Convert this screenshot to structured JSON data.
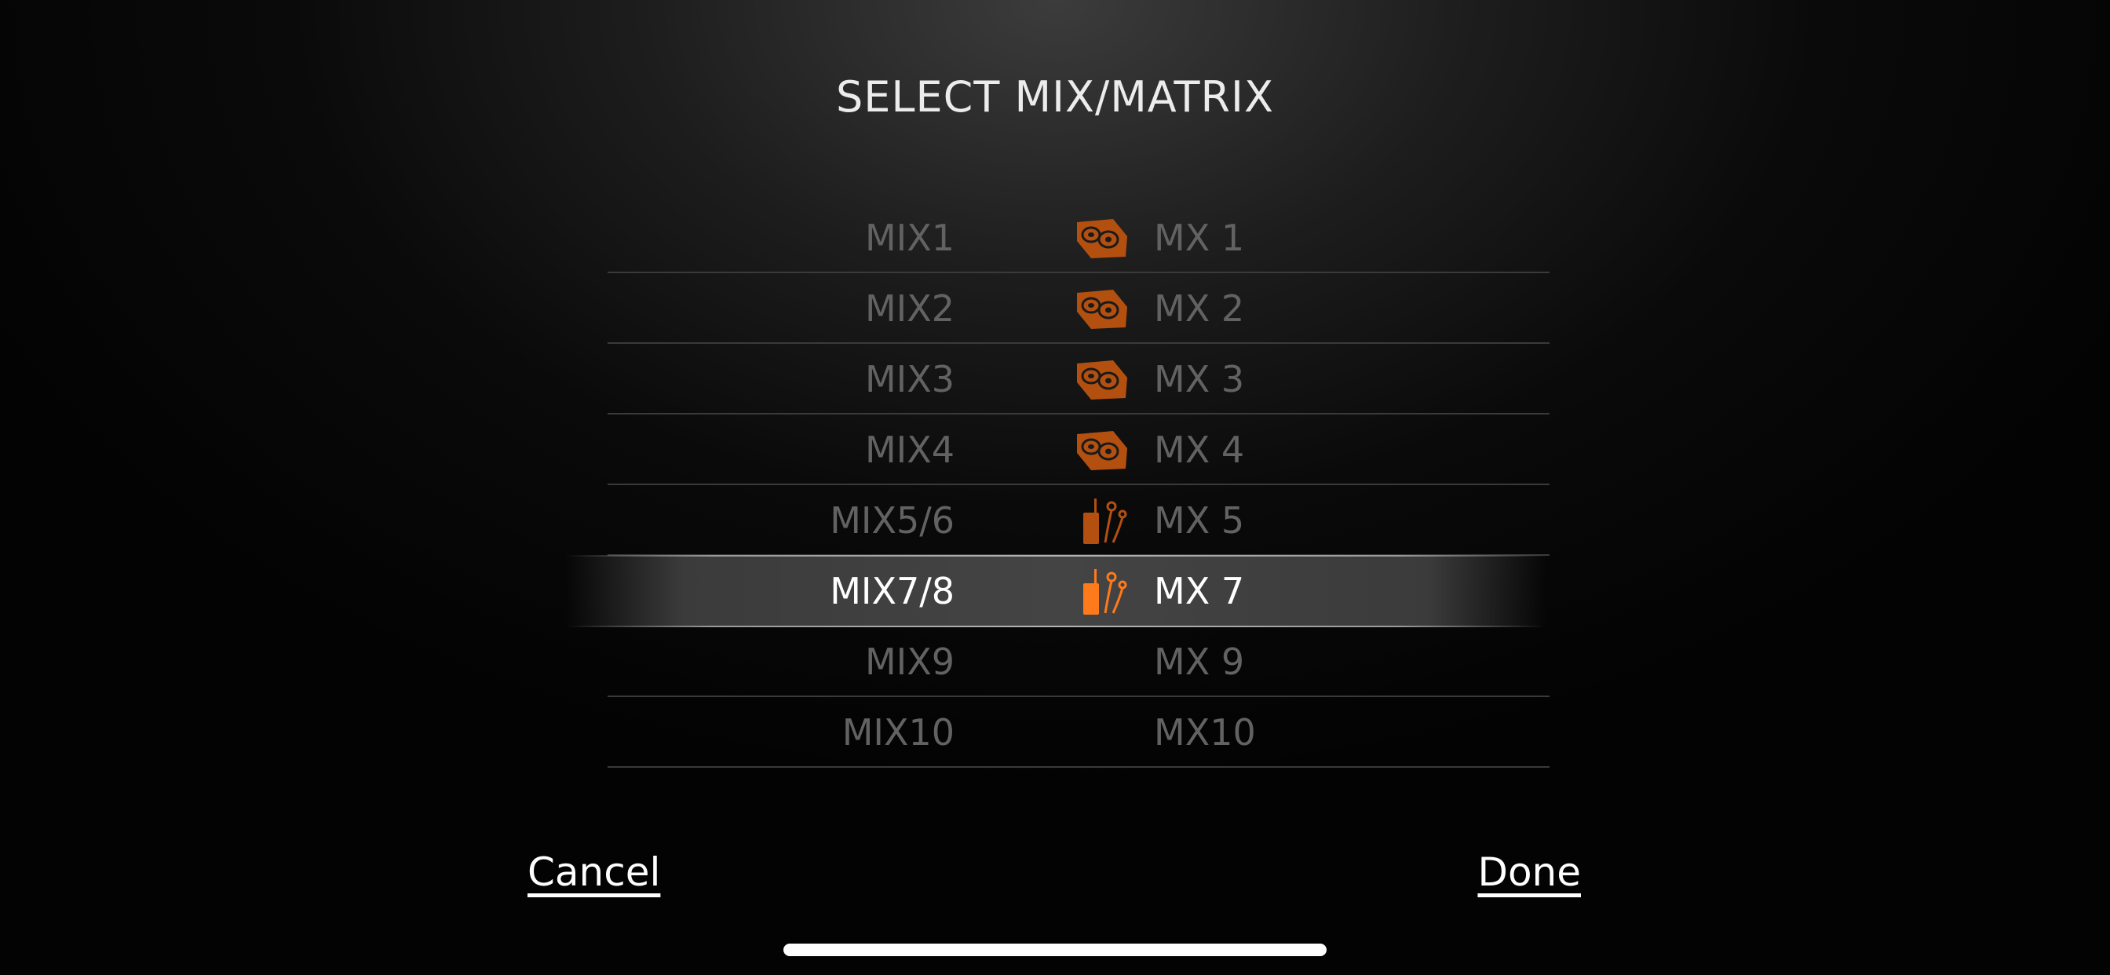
{
  "title": "SELECT MIX/MATRIX",
  "rows": [
    {
      "mix": "MIX1",
      "mx": "MX 1",
      "icon": "floor-monitor-icon"
    },
    {
      "mix": "MIX2",
      "mx": "MX 2",
      "icon": "floor-monitor-icon"
    },
    {
      "mix": "MIX3",
      "mx": "MX 3",
      "icon": "floor-monitor-icon"
    },
    {
      "mix": "MIX4",
      "mx": "MX 4",
      "icon": "floor-monitor-icon"
    },
    {
      "mix": "MIX5/6",
      "mx": "MX 5",
      "icon": "in-ear-monitor-icon"
    },
    {
      "mix": "MIX7/8",
      "mx": "MX 7",
      "icon": "in-ear-monitor-icon",
      "selected": true
    },
    {
      "mix": "MIX9",
      "mx": "MX 9",
      "icon": ""
    },
    {
      "mix": "MIX10",
      "mx": "MX10",
      "icon": ""
    }
  ],
  "buttons": {
    "cancel": "Cancel",
    "done": "Done"
  },
  "colors": {
    "icon_dim": "#b4500f",
    "icon_active": "#ff7a1a",
    "text_dim": "#626262",
    "text_active": "#ffffff"
  }
}
